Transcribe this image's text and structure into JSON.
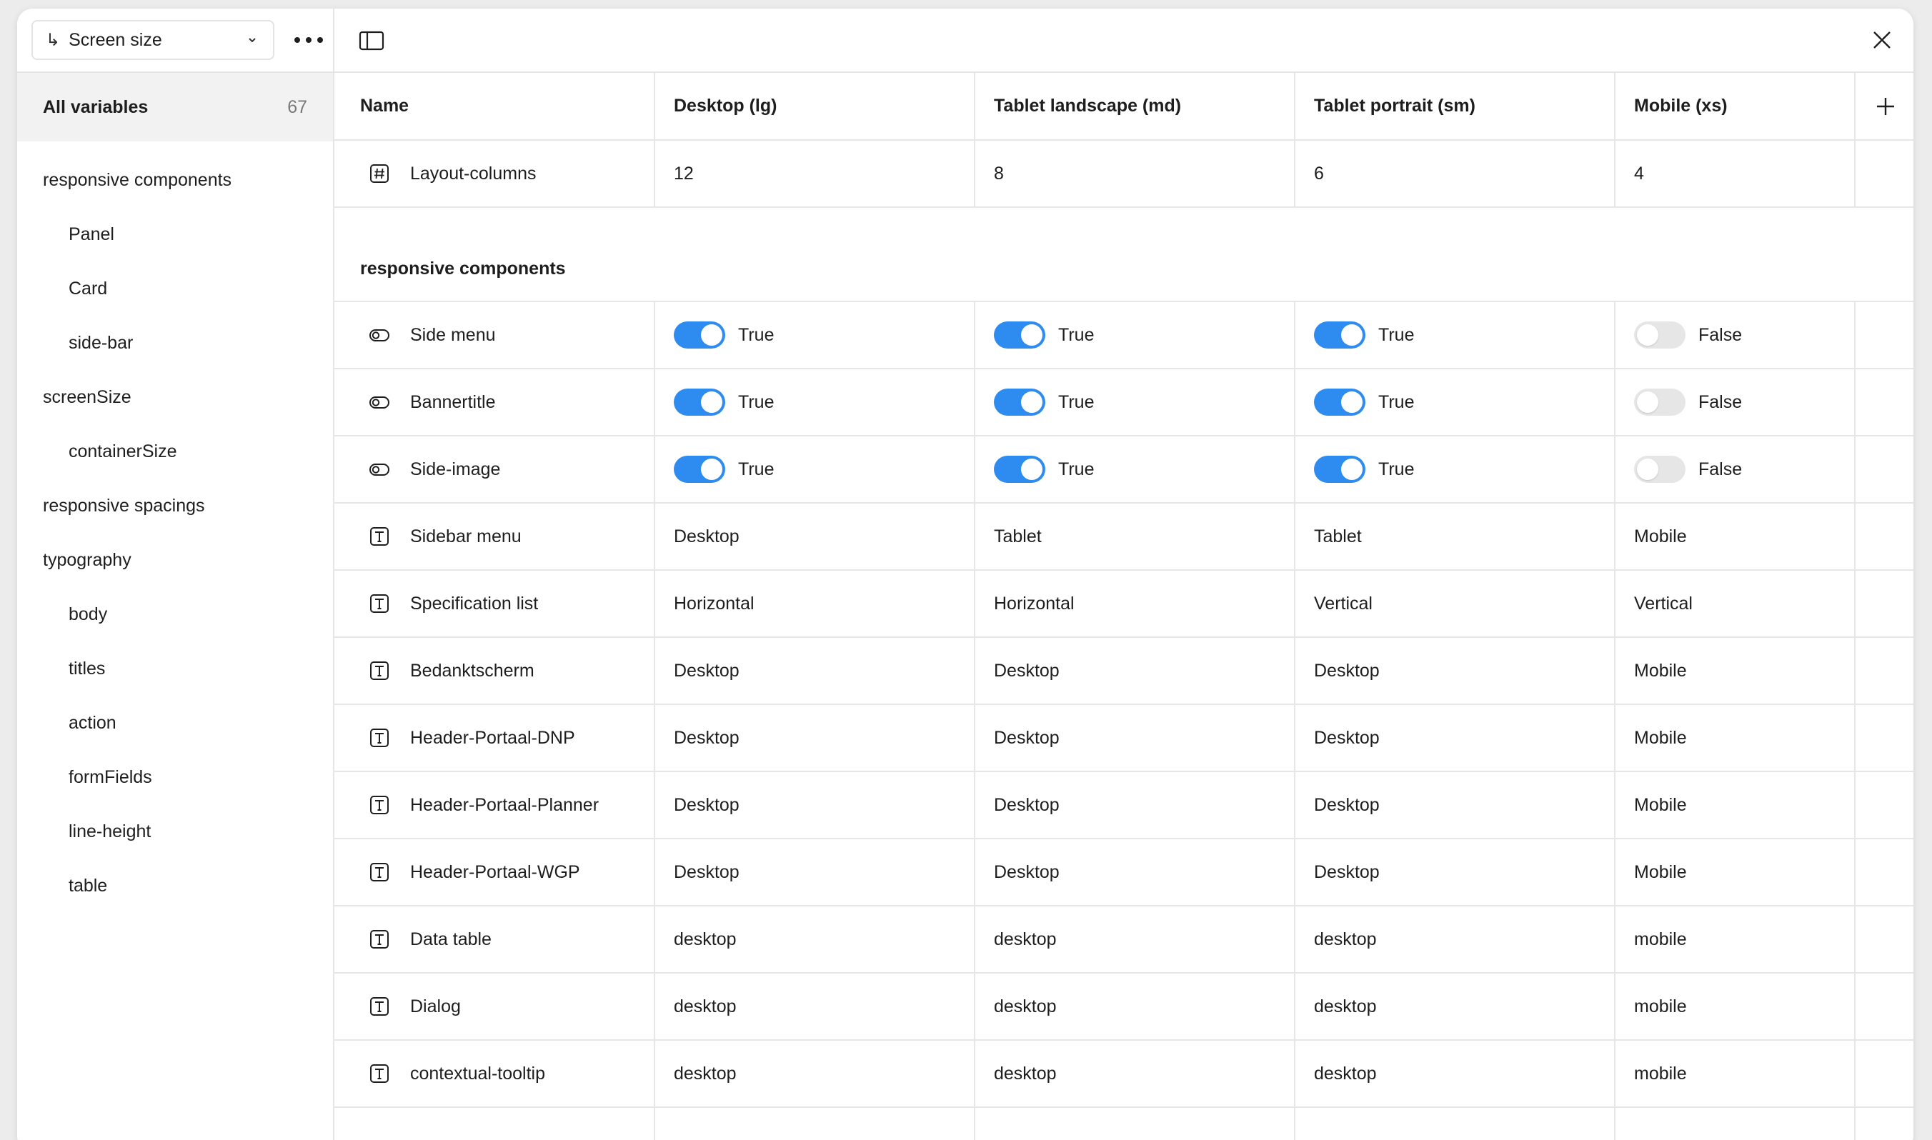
{
  "mode_select": {
    "label": "Screen size",
    "arrow_icon": "return-arrow-icon"
  },
  "sidebar": {
    "all_variables": {
      "label": "All variables",
      "count": "67"
    },
    "groups": [
      {
        "label": "responsive components",
        "level": 0
      },
      {
        "label": "Panel",
        "level": 1
      },
      {
        "label": "Card",
        "level": 1
      },
      {
        "label": "side-bar",
        "level": 1
      },
      {
        "label": "screenSize",
        "level": 0
      },
      {
        "label": "containerSize",
        "level": 1
      },
      {
        "label": "responsive spacings",
        "level": 0
      },
      {
        "label": "typography",
        "level": 0
      },
      {
        "label": "body",
        "level": 1
      },
      {
        "label": "titles",
        "level": 1
      },
      {
        "label": "action",
        "level": 1
      },
      {
        "label": "formFields",
        "level": 1
      },
      {
        "label": "line-height",
        "level": 1
      },
      {
        "label": "table",
        "level": 1
      }
    ]
  },
  "table": {
    "columns": [
      "Name",
      "Desktop (lg)",
      "Tablet landscape (md)",
      "Tablet portrait (sm)",
      "Mobile (xs)"
    ],
    "top_rows": [
      {
        "name": "Layout-columns",
        "type": "number",
        "values": [
          "12",
          "8",
          "6",
          "4"
        ]
      }
    ],
    "group_title": "responsive components",
    "rows": [
      {
        "name": "Side menu",
        "type": "boolean",
        "values": [
          "True",
          "True",
          "True",
          "False"
        ]
      },
      {
        "name": "Bannertitle",
        "type": "boolean",
        "values": [
          "True",
          "True",
          "True",
          "False"
        ]
      },
      {
        "name": "Side-image",
        "type": "boolean",
        "values": [
          "True",
          "True",
          "True",
          "False"
        ]
      },
      {
        "name": "Sidebar menu",
        "type": "string",
        "values": [
          "Desktop",
          "Tablet",
          "Tablet",
          "Mobile"
        ]
      },
      {
        "name": "Specification list",
        "type": "string",
        "values": [
          "Horizontal",
          "Horizontal",
          "Vertical",
          "Vertical"
        ]
      },
      {
        "name": "Bedanktscherm",
        "type": "string",
        "values": [
          "Desktop",
          "Desktop",
          "Desktop",
          "Mobile"
        ]
      },
      {
        "name": "Header-Portaal-DNP",
        "type": "string",
        "values": [
          "Desktop",
          "Desktop",
          "Desktop",
          "Mobile"
        ]
      },
      {
        "name": "Header-Portaal-Planner",
        "type": "string",
        "values": [
          "Desktop",
          "Desktop",
          "Desktop",
          "Mobile"
        ]
      },
      {
        "name": "Header-Portaal-WGP",
        "type": "string",
        "values": [
          "Desktop",
          "Desktop",
          "Desktop",
          "Mobile"
        ]
      },
      {
        "name": "Data table",
        "type": "string",
        "values": [
          "desktop",
          "desktop",
          "desktop",
          "mobile"
        ]
      },
      {
        "name": "Dialog",
        "type": "string",
        "values": [
          "desktop",
          "desktop",
          "desktop",
          "mobile"
        ]
      },
      {
        "name": "contextual-tooltip",
        "type": "string",
        "values": [
          "desktop",
          "desktop",
          "desktop",
          "mobile"
        ]
      },
      {
        "name": "",
        "type": "string",
        "values": [
          "",
          "",
          "",
          ""
        ]
      }
    ]
  },
  "colors": {
    "accent": "#2e8cf0",
    "toggle_off": "#e6e6e6",
    "border": "#e6e6e6",
    "selected_bg": "#f2f2f2"
  }
}
